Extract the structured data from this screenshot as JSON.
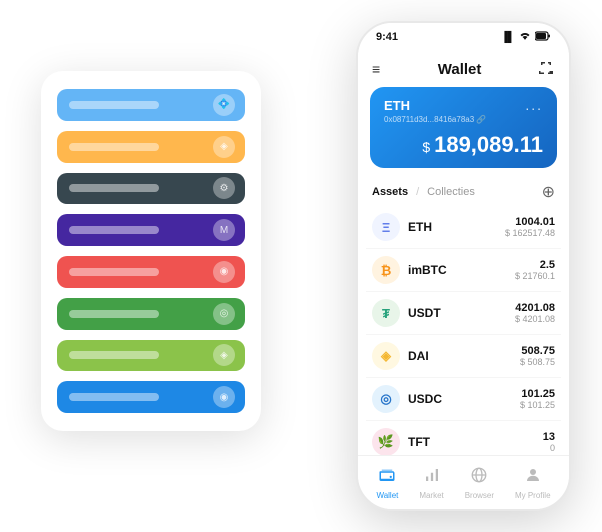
{
  "colors": {
    "accent": "#2196F3",
    "bg": "#ffffff",
    "row1": "#64B5F6",
    "row2": "#FFB74D",
    "row3": "#37474F",
    "row4": "#4527A0",
    "row5": "#EF5350",
    "row6": "#43A047",
    "row7": "#8BC34A",
    "row8": "#1E88E5"
  },
  "status_bar": {
    "time": "9:41",
    "signal": "▐▌",
    "wifi": "wifi",
    "battery": "▮"
  },
  "header": {
    "title": "Wallet",
    "menu_icon": "≡",
    "expand_icon": "⤢"
  },
  "wallet_card": {
    "coin_label": "ETH",
    "address": "0x08711d3d...8416a78a3 🔗",
    "balance_prefix": "$ ",
    "balance": "189,089.11",
    "more_icon": "..."
  },
  "assets": {
    "tab_active": "Assets",
    "tab_divider": "/",
    "tab_inactive": "Collecties",
    "add_icon": "⊕",
    "items": [
      {
        "name": "ETH",
        "amount": "1004.01",
        "usd": "$ 162517.48",
        "icon_color": "#627EEA",
        "icon_text": "Ξ",
        "icon_bg": "#f0f4ff"
      },
      {
        "name": "imBTC",
        "amount": "2.5",
        "usd": "$ 21760.1",
        "icon_color": "#F7931A",
        "icon_text": "₿",
        "icon_bg": "#fff3e0"
      },
      {
        "name": "USDT",
        "amount": "4201.08",
        "usd": "$ 4201.08",
        "icon_color": "#26A17B",
        "icon_text": "₮",
        "icon_bg": "#e8f5e9"
      },
      {
        "name": "DAI",
        "amount": "508.75",
        "usd": "$ 508.75",
        "icon_color": "#F4B731",
        "icon_text": "◈",
        "icon_bg": "#fff8e1"
      },
      {
        "name": "USDC",
        "amount": "101.25",
        "usd": "$ 101.25",
        "icon_color": "#2775CA",
        "icon_text": "◎",
        "icon_bg": "#e3f2fd"
      },
      {
        "name": "TFT",
        "amount": "13",
        "usd": "0",
        "icon_color": "#E91E63",
        "icon_text": "🌿",
        "icon_bg": "#fce4ec"
      }
    ]
  },
  "bottom_nav": {
    "items": [
      {
        "label": "Wallet",
        "icon": "👛",
        "active": true
      },
      {
        "label": "Market",
        "icon": "📊",
        "active": false
      },
      {
        "label": "Browser",
        "icon": "🌐",
        "active": false
      },
      {
        "label": "My Profile",
        "icon": "👤",
        "active": false
      }
    ]
  },
  "bg_rows": [
    {
      "color": "#64B5F6",
      "icon": "💠"
    },
    {
      "color": "#FFB74D",
      "icon": "◈"
    },
    {
      "color": "#37474F",
      "icon": "⚙"
    },
    {
      "color": "#4527A0",
      "icon": "M"
    },
    {
      "color": "#EF5350",
      "icon": "◉"
    },
    {
      "color": "#43A047",
      "icon": "◎"
    },
    {
      "color": "#8BC34A",
      "icon": "◈"
    },
    {
      "color": "#1E88E5",
      "icon": "◉"
    }
  ]
}
